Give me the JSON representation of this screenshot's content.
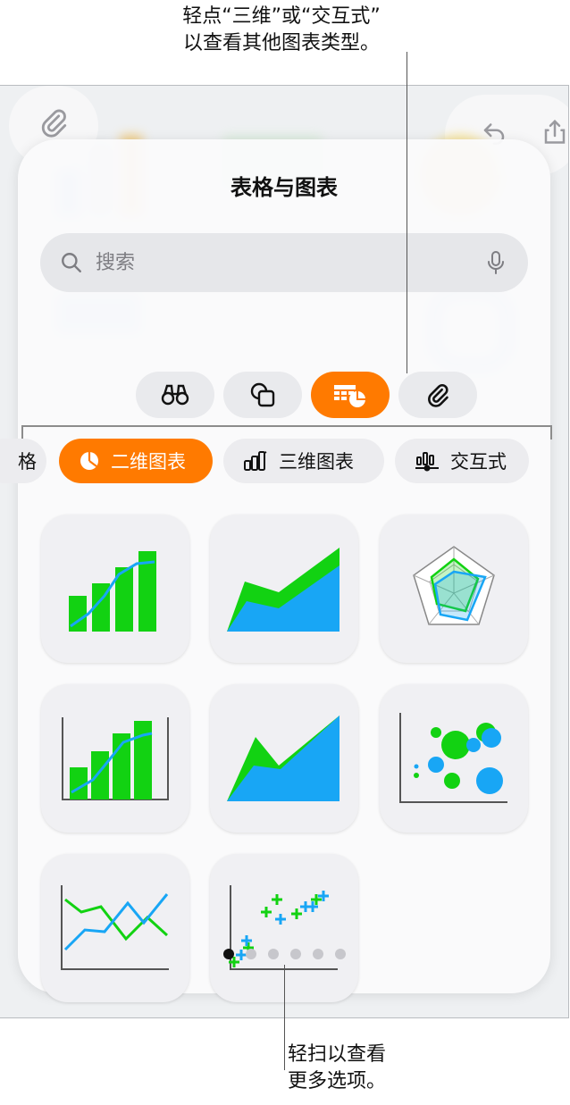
{
  "callouts": {
    "top_line1": "轻点“三维”或“交互式”",
    "top_line2": "以查看其他图表类型。",
    "bottom_line1": "轻扫以查看",
    "bottom_line2": "更多选项。"
  },
  "sheet": {
    "title": "表格与图表",
    "search_placeholder": "搜索"
  },
  "categories": [
    {
      "icon": "binoculars-icon",
      "active": false
    },
    {
      "icon": "shapes-icon",
      "active": false
    },
    {
      "icon": "table-chart-icon",
      "active": true
    },
    {
      "icon": "paperclip-icon",
      "active": false
    }
  ],
  "chart_tabs": [
    {
      "label": "格",
      "icon": "",
      "active": false
    },
    {
      "label": "二维图表",
      "icon": "pie-icon",
      "active": true
    },
    {
      "label": "三维图表",
      "icon": "3d-bar-icon",
      "active": false
    },
    {
      "label": "交互式",
      "icon": "interactive-chart-icon",
      "active": false
    }
  ],
  "chart_types": [
    "bar-line-mixed-icon",
    "area-icon",
    "radar-icon",
    "bar-line-axes-icon",
    "area-axes-icon",
    "bubble-icon",
    "line-icon",
    "scatter-icon"
  ],
  "pagination": {
    "total": 6,
    "current": 1
  },
  "colors": {
    "accent": "#ff7a00",
    "green": "#12d212",
    "blue": "#18a6f5"
  }
}
